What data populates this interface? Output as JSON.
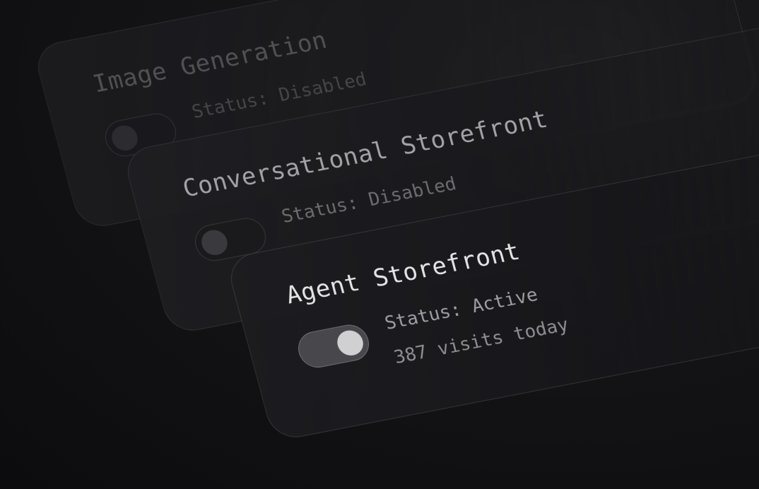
{
  "cards": [
    {
      "title": "Image Generation",
      "status": "Status: Disabled",
      "toggle_state": "off"
    },
    {
      "title": "Conversational Storefront",
      "status": "Status: Disabled",
      "toggle_state": "off"
    },
    {
      "title": "Agent Storefront",
      "status": "Status: Active",
      "visits": "387 visits today",
      "toggle_state": "on"
    }
  ]
}
